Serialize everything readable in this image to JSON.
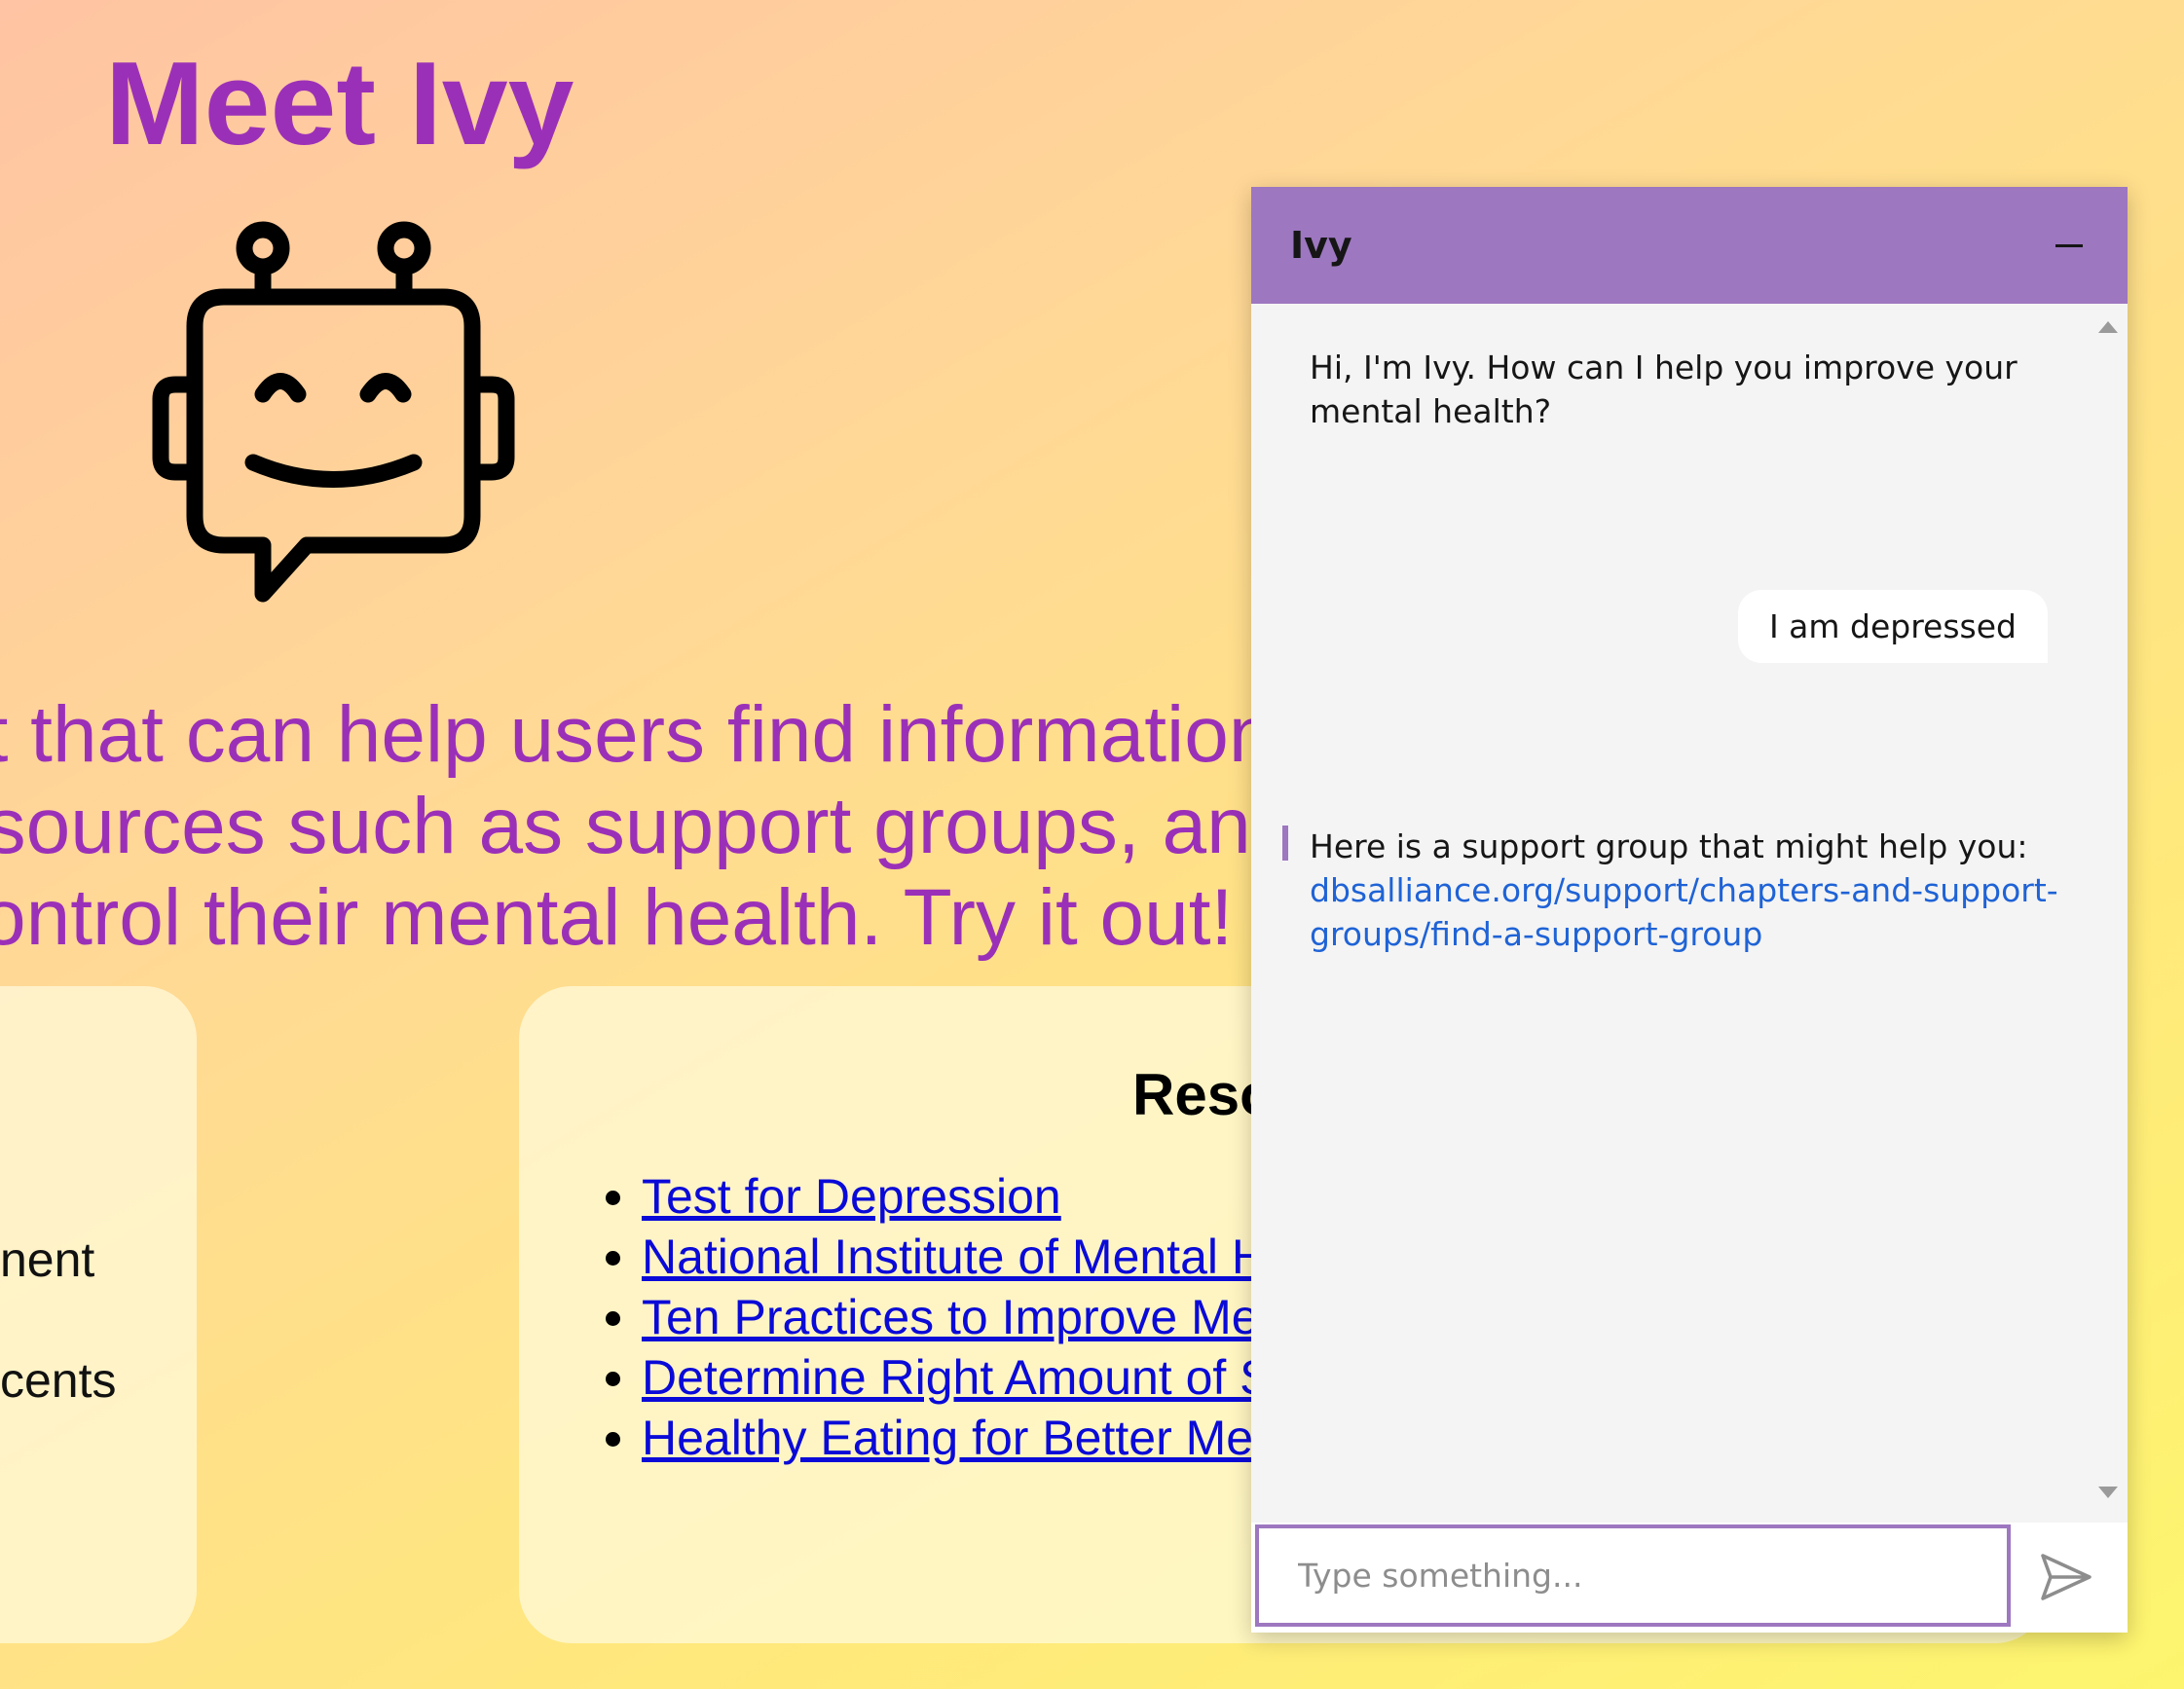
{
  "page": {
    "title": "Meet Ivy",
    "intro_lines": [
      "ot that can help users find information",
      "esources such as support groups, and support",
      "control their mental health. Try it out!"
    ],
    "left_card_fragments": [
      "nent",
      "cents"
    ],
    "resources": {
      "heading": "Resources",
      "links": [
        "Test for Depression",
        "National Institute of Mental Health",
        "Ten Practices to Improve Mental Health",
        "Determine Right Amount of Sleep",
        "Healthy Eating for Better Mental Health"
      ]
    },
    "logo_icon": "robot-chat-icon"
  },
  "chat": {
    "title": "Ivy",
    "minimize_icon": "minimize-icon",
    "messages": {
      "bot_greeting": "Hi, I'm Ivy. How can I help you improve your mental health?",
      "user_message": "I am depressed",
      "bot_reply_text": "Here is a support group that might help you:",
      "bot_reply_link": "dbsalliance.org/support/chapters-and-support-groups/find-a-support-group"
    },
    "input": {
      "placeholder": "Type something...",
      "value": ""
    },
    "send_icon": "send-icon",
    "colors": {
      "accent": "#9d77c0",
      "page_heading": "#9b30b8",
      "link": "#1f63d6"
    }
  }
}
